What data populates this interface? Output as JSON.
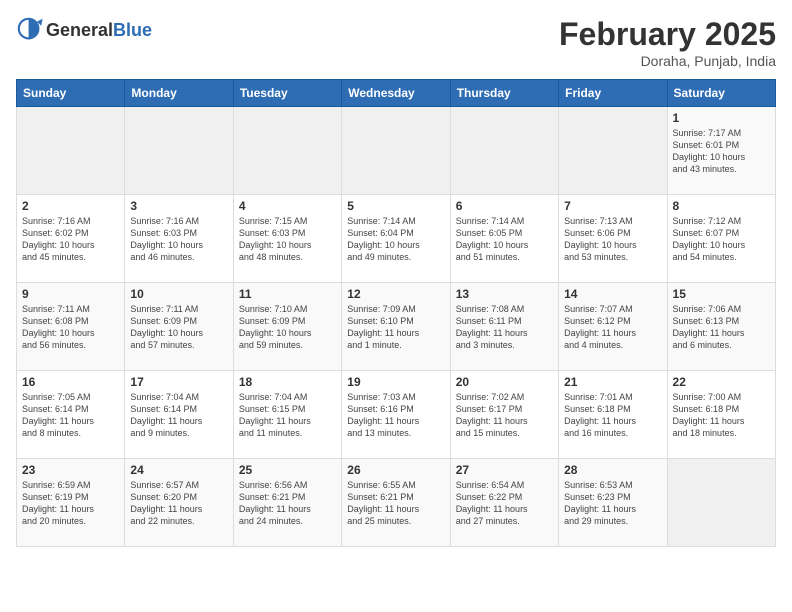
{
  "header": {
    "logo_general": "General",
    "logo_blue": "Blue",
    "month": "February 2025",
    "location": "Doraha, Punjab, India"
  },
  "weekdays": [
    "Sunday",
    "Monday",
    "Tuesday",
    "Wednesday",
    "Thursday",
    "Friday",
    "Saturday"
  ],
  "weeks": [
    [
      {
        "day": "",
        "info": ""
      },
      {
        "day": "",
        "info": ""
      },
      {
        "day": "",
        "info": ""
      },
      {
        "day": "",
        "info": ""
      },
      {
        "day": "",
        "info": ""
      },
      {
        "day": "",
        "info": ""
      },
      {
        "day": "1",
        "info": "Sunrise: 7:17 AM\nSunset: 6:01 PM\nDaylight: 10 hours\nand 43 minutes."
      }
    ],
    [
      {
        "day": "2",
        "info": "Sunrise: 7:16 AM\nSunset: 6:02 PM\nDaylight: 10 hours\nand 45 minutes."
      },
      {
        "day": "3",
        "info": "Sunrise: 7:16 AM\nSunset: 6:03 PM\nDaylight: 10 hours\nand 46 minutes."
      },
      {
        "day": "4",
        "info": "Sunrise: 7:15 AM\nSunset: 6:03 PM\nDaylight: 10 hours\nand 48 minutes."
      },
      {
        "day": "5",
        "info": "Sunrise: 7:14 AM\nSunset: 6:04 PM\nDaylight: 10 hours\nand 49 minutes."
      },
      {
        "day": "6",
        "info": "Sunrise: 7:14 AM\nSunset: 6:05 PM\nDaylight: 10 hours\nand 51 minutes."
      },
      {
        "day": "7",
        "info": "Sunrise: 7:13 AM\nSunset: 6:06 PM\nDaylight: 10 hours\nand 53 minutes."
      },
      {
        "day": "8",
        "info": "Sunrise: 7:12 AM\nSunset: 6:07 PM\nDaylight: 10 hours\nand 54 minutes."
      }
    ],
    [
      {
        "day": "9",
        "info": "Sunrise: 7:11 AM\nSunset: 6:08 PM\nDaylight: 10 hours\nand 56 minutes."
      },
      {
        "day": "10",
        "info": "Sunrise: 7:11 AM\nSunset: 6:09 PM\nDaylight: 10 hours\nand 57 minutes."
      },
      {
        "day": "11",
        "info": "Sunrise: 7:10 AM\nSunset: 6:09 PM\nDaylight: 10 hours\nand 59 minutes."
      },
      {
        "day": "12",
        "info": "Sunrise: 7:09 AM\nSunset: 6:10 PM\nDaylight: 11 hours\nand 1 minute."
      },
      {
        "day": "13",
        "info": "Sunrise: 7:08 AM\nSunset: 6:11 PM\nDaylight: 11 hours\nand 3 minutes."
      },
      {
        "day": "14",
        "info": "Sunrise: 7:07 AM\nSunset: 6:12 PM\nDaylight: 11 hours\nand 4 minutes."
      },
      {
        "day": "15",
        "info": "Sunrise: 7:06 AM\nSunset: 6:13 PM\nDaylight: 11 hours\nand 6 minutes."
      }
    ],
    [
      {
        "day": "16",
        "info": "Sunrise: 7:05 AM\nSunset: 6:14 PM\nDaylight: 11 hours\nand 8 minutes."
      },
      {
        "day": "17",
        "info": "Sunrise: 7:04 AM\nSunset: 6:14 PM\nDaylight: 11 hours\nand 9 minutes."
      },
      {
        "day": "18",
        "info": "Sunrise: 7:04 AM\nSunset: 6:15 PM\nDaylight: 11 hours\nand 11 minutes."
      },
      {
        "day": "19",
        "info": "Sunrise: 7:03 AM\nSunset: 6:16 PM\nDaylight: 11 hours\nand 13 minutes."
      },
      {
        "day": "20",
        "info": "Sunrise: 7:02 AM\nSunset: 6:17 PM\nDaylight: 11 hours\nand 15 minutes."
      },
      {
        "day": "21",
        "info": "Sunrise: 7:01 AM\nSunset: 6:18 PM\nDaylight: 11 hours\nand 16 minutes."
      },
      {
        "day": "22",
        "info": "Sunrise: 7:00 AM\nSunset: 6:18 PM\nDaylight: 11 hours\nand 18 minutes."
      }
    ],
    [
      {
        "day": "23",
        "info": "Sunrise: 6:59 AM\nSunset: 6:19 PM\nDaylight: 11 hours\nand 20 minutes."
      },
      {
        "day": "24",
        "info": "Sunrise: 6:57 AM\nSunset: 6:20 PM\nDaylight: 11 hours\nand 22 minutes."
      },
      {
        "day": "25",
        "info": "Sunrise: 6:56 AM\nSunset: 6:21 PM\nDaylight: 11 hours\nand 24 minutes."
      },
      {
        "day": "26",
        "info": "Sunrise: 6:55 AM\nSunset: 6:21 PM\nDaylight: 11 hours\nand 25 minutes."
      },
      {
        "day": "27",
        "info": "Sunrise: 6:54 AM\nSunset: 6:22 PM\nDaylight: 11 hours\nand 27 minutes."
      },
      {
        "day": "28",
        "info": "Sunrise: 6:53 AM\nSunset: 6:23 PM\nDaylight: 11 hours\nand 29 minutes."
      },
      {
        "day": "",
        "info": ""
      }
    ]
  ]
}
